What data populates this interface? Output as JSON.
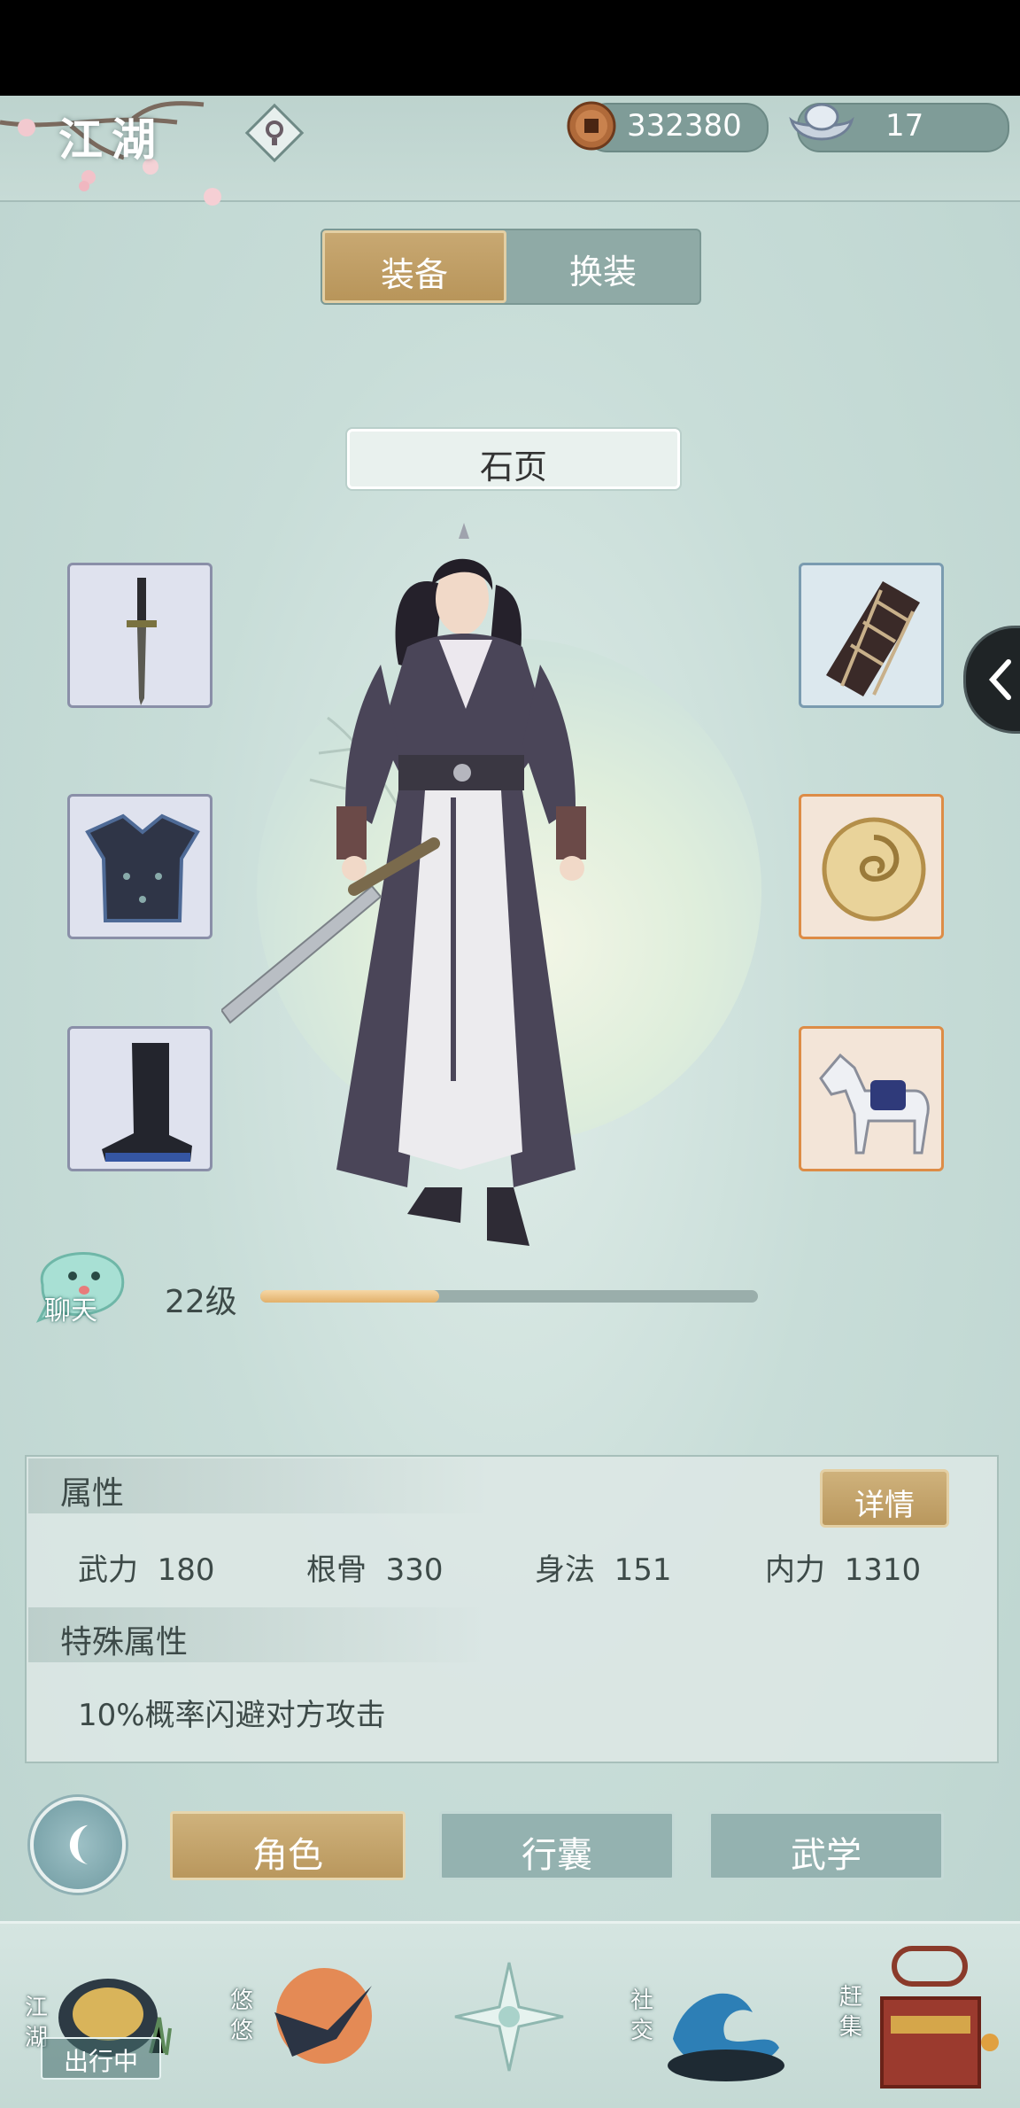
{
  "header": {
    "location_title": "江湖",
    "coins": "332380",
    "ingots": "17"
  },
  "segments": {
    "equip": "装备",
    "swap": "换装"
  },
  "character": {
    "name": "石页",
    "level": "22级",
    "xp_fraction": 0.36
  },
  "chat": {
    "label": "聊天"
  },
  "equipment": {
    "left": [
      "sword-icon",
      "armor-icon",
      "boots-icon"
    ],
    "right": [
      "bracer-icon",
      "jade-pendant-icon",
      "horse-icon"
    ]
  },
  "attributes": {
    "title": "属性",
    "detail_button": "详情",
    "stats": [
      {
        "name": "武力",
        "value": "180"
      },
      {
        "name": "根骨",
        "value": "330"
      },
      {
        "name": "身法",
        "value": "151"
      },
      {
        "name": "内力",
        "value": "1310"
      }
    ],
    "special_title": "特殊属性",
    "special_text": "10%概率闪避对方攻击"
  },
  "tabs": [
    "角色",
    "行囊",
    "武学"
  ],
  "nav": {
    "jianghu": "江湖",
    "youyou": "悠悠",
    "shejiao": "社交",
    "ganji": "赶集",
    "traveling": "出行中"
  },
  "colors": {
    "gold": "#b9975d",
    "teal": "#94b2b0",
    "background": "#c9dcd7"
  }
}
